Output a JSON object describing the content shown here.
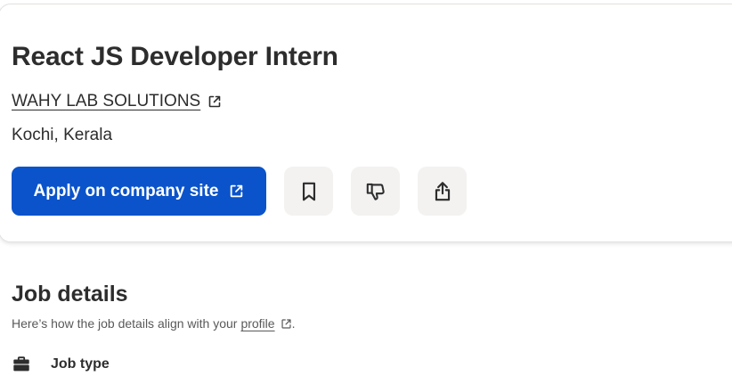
{
  "job": {
    "title": "React JS Developer Intern",
    "company": "WAHY LAB SOLUTIONS",
    "location": "Kochi, Kerala",
    "apply_label": "Apply on company site",
    "apply_color": "#0a53ca"
  },
  "actions": {
    "save_icon": "bookmark-icon",
    "dislike_icon": "thumbs-down-icon",
    "share_icon": "share-icon"
  },
  "details": {
    "title": "Job details",
    "subtitle_prefix": "Here’s how the job details align with your",
    "profile_link": "profile",
    "subtitle_suffix": ".",
    "job_type_label": "Job type",
    "job_type_icon": "briefcase-icon"
  }
}
